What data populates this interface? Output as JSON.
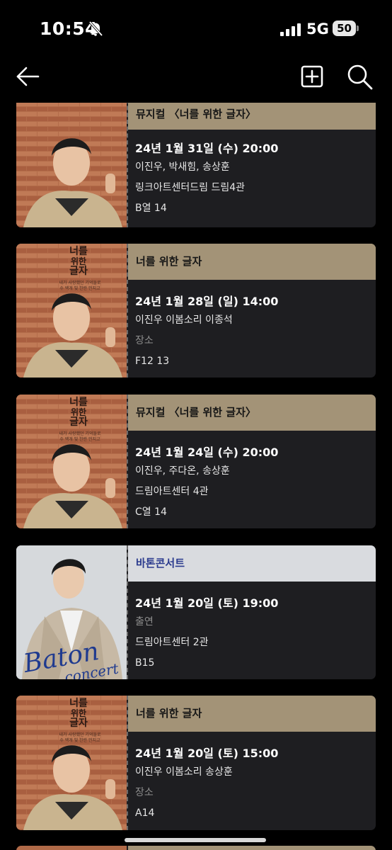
{
  "status": {
    "time": "10:54",
    "network": "5G",
    "battery": "50"
  },
  "nav": {
    "back_icon": "back-arrow-icon",
    "add_icon": "plus-square-icon",
    "search_icon": "search-icon"
  },
  "poster_text": {
    "title_lines": [
      "너를",
      "위한",
      "글자"
    ],
    "subtitle": "내가 사랑했던 기억들로\n수 백개 빛 찬란 만지고",
    "baton_line1": "Baton",
    "baton_line2": "concert"
  },
  "tickets": [
    {
      "title": "뮤지컬 〈너를 위한 글자〉",
      "date": "24년 1월 31일 (수) 20:00",
      "cast": "이진우, 박새힘, 송상훈",
      "venue": "링크아트센터드림 드림4관",
      "seat": "B열 14",
      "style": "gold"
    },
    {
      "title": "너를 위한 글자",
      "date": "24년 1월 28일 (일) 14:00",
      "cast": "이진우 이봄소리 이종석",
      "venue": "장소",
      "seat": "F12 13",
      "style": "gold",
      "venue_muted": true
    },
    {
      "title": "뮤지컬 〈너를 위한 글자〉",
      "date": "24년 1월 24일 (수) 20:00",
      "cast": "이진우, 주다온, 송상훈",
      "venue": "드림아트센터 4관",
      "seat": "C열 14",
      "style": "gold"
    },
    {
      "title": "바톤콘서트",
      "date": "24년 1월 20일 (토) 19:00",
      "cast": "출연",
      "venue": "드림아트센터 2관",
      "seat": "B15",
      "style": "grey",
      "cast_muted": true
    },
    {
      "title": "너를 위한 글자",
      "date": "24년 1월 20일 (토) 15:00",
      "cast": "이진우 이봄소리 송상훈",
      "venue": "장소",
      "seat": "A14",
      "style": "gold",
      "venue_muted": true
    }
  ],
  "colors": {
    "gold_header": "#a39377",
    "grey_header": "#d9dbdf",
    "card_bg": "#1e1e21",
    "baton_blue": "#2b3b8e"
  }
}
